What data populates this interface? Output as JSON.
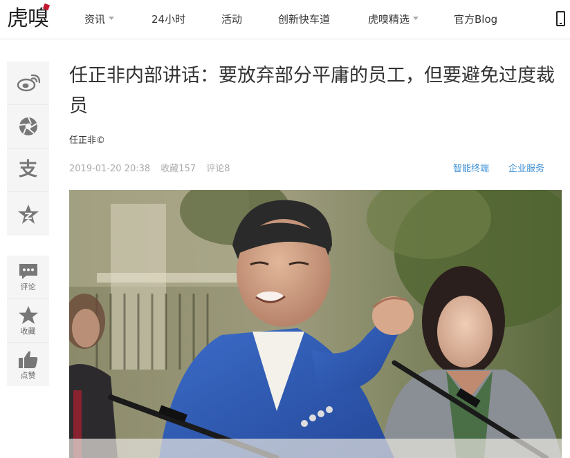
{
  "header": {
    "logo_text": "虎嗅",
    "nav": [
      {
        "label": "资讯",
        "has_dropdown": true
      },
      {
        "label": "24小时",
        "has_dropdown": false
      },
      {
        "label": "活动",
        "has_dropdown": false
      },
      {
        "label": "创新快车道",
        "has_dropdown": false
      },
      {
        "label": "虎嗅精选",
        "has_dropdown": true
      },
      {
        "label": "官方Blog",
        "has_dropdown": false
      }
    ],
    "right_icon": "mobile-phone-icon"
  },
  "share_bar": {
    "items": [
      "weibo-icon",
      "moments-icon",
      "zhihu-icon",
      "qzone-icon"
    ],
    "zhihu_glyph": "支"
  },
  "actions": [
    {
      "icon": "comment-icon",
      "label": "评论"
    },
    {
      "icon": "star-icon",
      "label": "收藏"
    },
    {
      "icon": "thumbs-up-icon",
      "label": "点赞"
    }
  ],
  "article": {
    "title": "任正非内部讲话：要放弃部分平庸的员工，但要避免过度裁员",
    "author": "任正非©",
    "date": "2019-01-20 20:38",
    "favorites": "收藏157",
    "comments": "评论8",
    "tags": [
      "智能终端",
      "企业服务"
    ]
  },
  "colors": {
    "brand_red": "#c5162e",
    "tag_blue": "#3c8fd4",
    "meta_gray": "#aaaaaa",
    "sidebar_bg": "#f5f5f5"
  }
}
